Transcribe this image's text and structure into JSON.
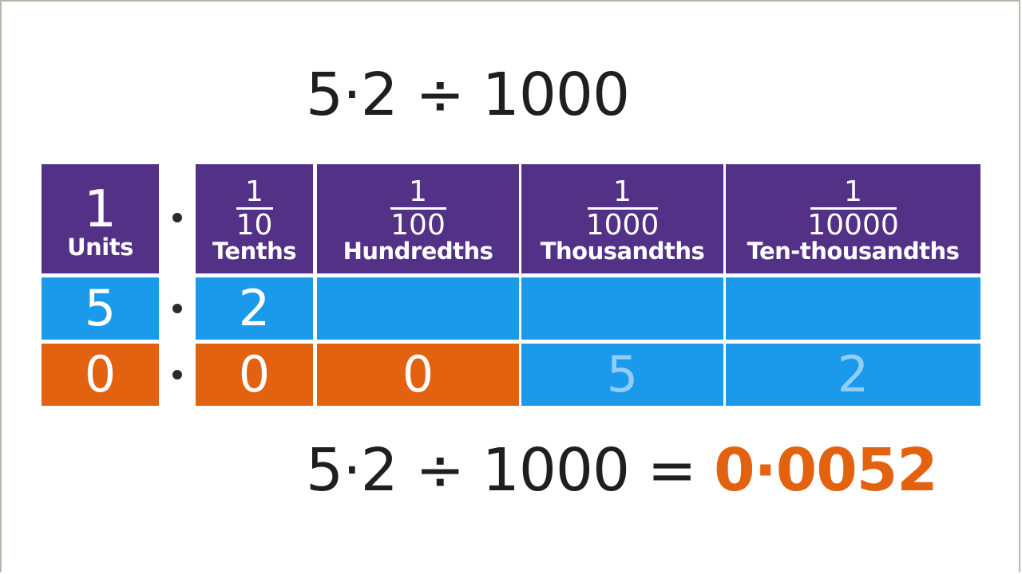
{
  "equation_top": "5·2 ÷ 1000",
  "equation_bottom": {
    "expression": "5·2 ÷ 1000 =",
    "answer": "0·0052"
  },
  "colors": {
    "header": "#533186",
    "original_row": "#1b9aec",
    "placeholder_zero": "#e3620f",
    "answer": "#e36210",
    "moved_digit": "#93cdf6"
  },
  "place_value_table": {
    "headers": [
      {
        "value": "1",
        "label": "Units"
      },
      {
        "numerator": "1",
        "denominator": "10",
        "label": "Tenths"
      },
      {
        "numerator": "1",
        "denominator": "100",
        "label": "Hundredths"
      },
      {
        "numerator": "1",
        "denominator": "1000",
        "label": "Thousandths"
      },
      {
        "numerator": "1",
        "denominator": "10000",
        "label": "Ten-thousandths"
      }
    ],
    "original_row": [
      "5",
      "2",
      "",
      "",
      ""
    ],
    "result_row": [
      "0",
      "0",
      "0",
      "5",
      "2"
    ],
    "decimal_point_symbol": "•"
  }
}
